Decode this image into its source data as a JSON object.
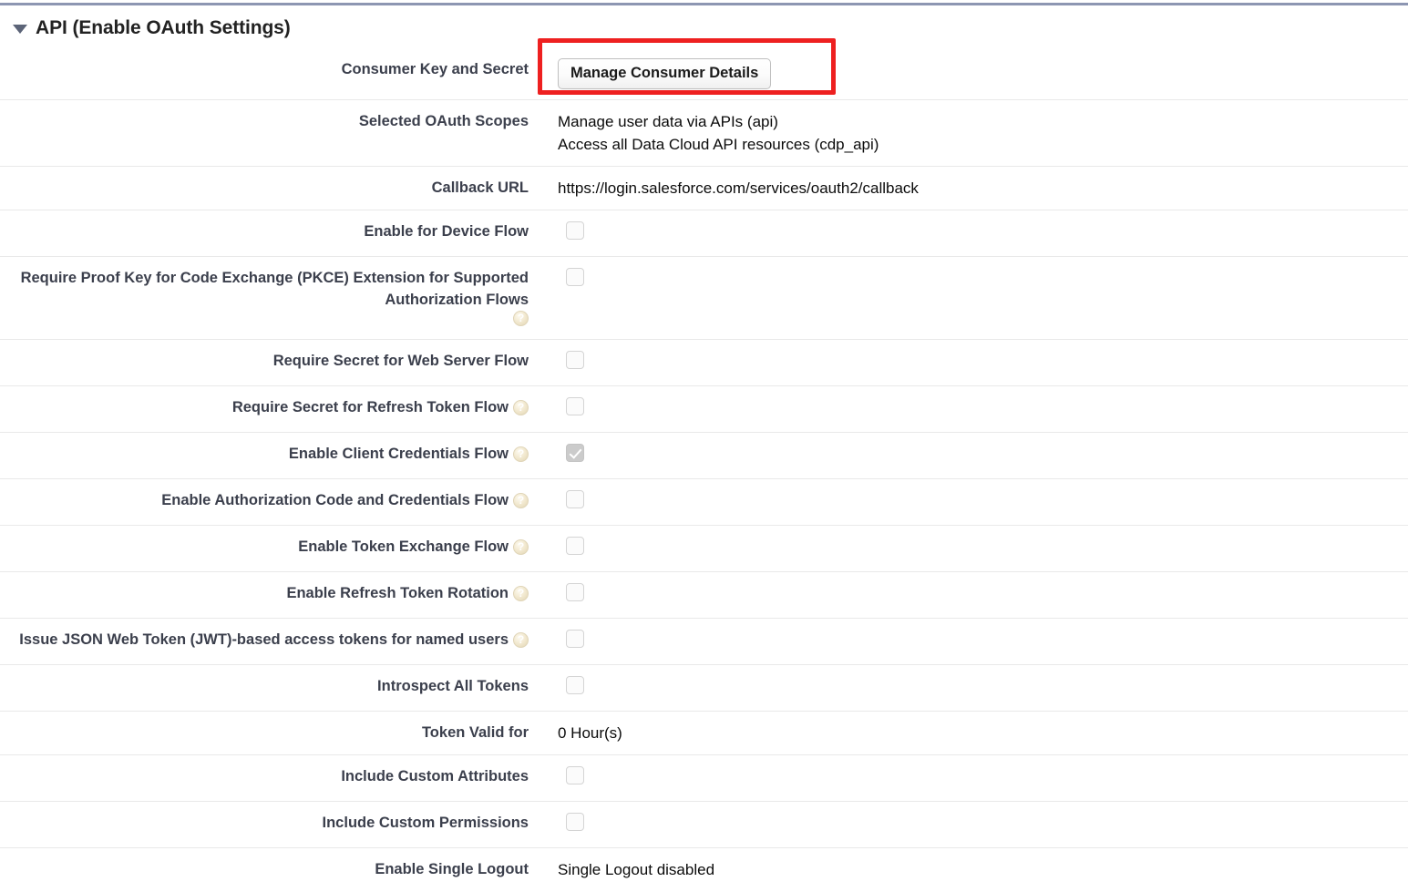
{
  "section": {
    "title": "API (Enable OAuth Settings)",
    "twisty_icon": "caret-down-icon",
    "expanded": true
  },
  "colors": {
    "top_rule": "#8d96b2",
    "highlight": "#ee2020",
    "row_separator": "#e9e9e9",
    "label_text": "#3b3f4c",
    "value_text": "#0b0b0b",
    "help_icon": "#f3ead2",
    "checkbox_checked_fill": "#cbcbcb"
  },
  "highlight": {
    "target": "manage-consumer-details-button",
    "color": "#ee2020"
  },
  "rows": [
    {
      "label": "Consumer Key and Secret",
      "help": false,
      "type": "button",
      "button_label": "Manage Consumer Details",
      "highlighted": true
    },
    {
      "label": "Selected OAuth Scopes",
      "help": false,
      "type": "multiline",
      "lines": [
        "Manage user data via APIs (api)",
        "Access all Data Cloud API resources (cdp_api)"
      ]
    },
    {
      "label": "Callback URL",
      "help": false,
      "type": "text",
      "value": "https://login.salesforce.com/services/oauth2/callback"
    },
    {
      "label": "Enable for Device Flow",
      "help": false,
      "type": "checkbox",
      "checked": false
    },
    {
      "label": "Require Proof Key for Code Exchange (PKCE) Extension for Supported Authorization Flows",
      "help": true,
      "type": "checkbox",
      "checked": false
    },
    {
      "label": "Require Secret for Web Server Flow",
      "help": false,
      "type": "checkbox",
      "checked": false
    },
    {
      "label": "Require Secret for Refresh Token Flow",
      "help": true,
      "type": "checkbox",
      "checked": false
    },
    {
      "label": "Enable Client Credentials Flow",
      "help": true,
      "type": "checkbox",
      "checked": true
    },
    {
      "label": "Enable Authorization Code and Credentials Flow",
      "help": true,
      "type": "checkbox",
      "checked": false
    },
    {
      "label": "Enable Token Exchange Flow",
      "help": true,
      "type": "checkbox",
      "checked": false
    },
    {
      "label": "Enable Refresh Token Rotation",
      "help": true,
      "type": "checkbox",
      "checked": false
    },
    {
      "label": "Issue JSON Web Token (JWT)-based access tokens for named users",
      "help": true,
      "type": "checkbox",
      "checked": false
    },
    {
      "label": "Introspect All Tokens",
      "help": false,
      "type": "checkbox",
      "checked": false
    },
    {
      "label": "Token Valid for",
      "help": false,
      "type": "text",
      "value": "0 Hour(s)"
    },
    {
      "label": "Include Custom Attributes",
      "help": false,
      "type": "checkbox",
      "checked": false
    },
    {
      "label": "Include Custom Permissions",
      "help": false,
      "type": "checkbox",
      "checked": false
    },
    {
      "label": "Enable Single Logout",
      "help": false,
      "type": "text",
      "value": "Single Logout disabled",
      "no_border": true
    }
  ]
}
